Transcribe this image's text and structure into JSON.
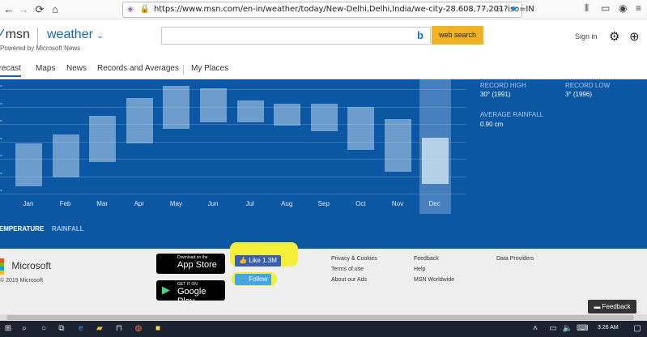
{
  "browser": {
    "url": "https://www.msn.com/en-in/weather/today/New-Delhi,Delhi,India/we-city-28.608,77,201?iso=IN",
    "back_icon": "back-arrow-icon",
    "forward_icon": "forward-arrow-icon",
    "reload_icon": "reload-icon",
    "home_icon": "home-icon"
  },
  "header": {
    "brand": "msn",
    "section": "weather",
    "powered_by": "Powered by Microsoft News",
    "search_placeholder": "",
    "search_button": "web search",
    "signin": "Sign in"
  },
  "tabs": [
    {
      "label": "Forecast",
      "active": true
    },
    {
      "label": "Maps",
      "active": false
    },
    {
      "label": "News",
      "active": false
    },
    {
      "label": "Records and Averages",
      "active": false
    },
    {
      "label": "My Places",
      "active": false
    }
  ],
  "chart_data": {
    "type": "bar",
    "categories": [
      "Jan",
      "Feb",
      "Mar",
      "Apr",
      "May",
      "Jun",
      "Jul",
      "Aug",
      "Sep",
      "Oct",
      "Nov",
      "Dec"
    ],
    "ranges": [
      [
        7,
        21
      ],
      [
        10,
        24
      ],
      [
        15,
        30
      ],
      [
        21,
        36
      ],
      [
        26,
        40
      ],
      [
        28,
        39
      ],
      [
        28,
        35
      ],
      [
        27,
        34
      ],
      [
        25,
        34
      ],
      [
        19,
        33
      ],
      [
        12,
        29
      ],
      [
        8,
        23
      ]
    ],
    "selected": "Dec",
    "y_ticks": [
      "°",
      "°",
      "°",
      "°",
      "°",
      "°",
      "°"
    ],
    "ylim": [
      5,
      42
    ]
  },
  "stats": {
    "record_high_label": "RECORD HIGH",
    "record_high_value": "30° (1991)",
    "record_low_label": "RECORD LOW",
    "record_low_value": "3° (1996)",
    "avg_rainfall_label": "AVERAGE RAINFALL",
    "avg_rainfall_value": "0.90 cm"
  },
  "toggles": {
    "temperature": "TEMPERATURE",
    "rainfall": "RAINFALL"
  },
  "footer": {
    "brand": "Microsoft",
    "copyright": "© 2019 Microsoft",
    "appstore_small": "Download on the",
    "appstore_big": "App Store",
    "play_small": "GET IT ON",
    "play_big": "Google Play",
    "like": "Like 1.3M",
    "follow": "Follow",
    "links_col1": [
      "Privacy & Cookies",
      "Terms of use",
      "About our Ads"
    ],
    "links_col2": [
      "Feedback",
      "Help",
      "MSN Worldwide"
    ],
    "links_col3": [
      "Data Providers"
    ],
    "feedback_button": "Feedback"
  },
  "taskbar": {
    "time": "3:26 AM"
  }
}
